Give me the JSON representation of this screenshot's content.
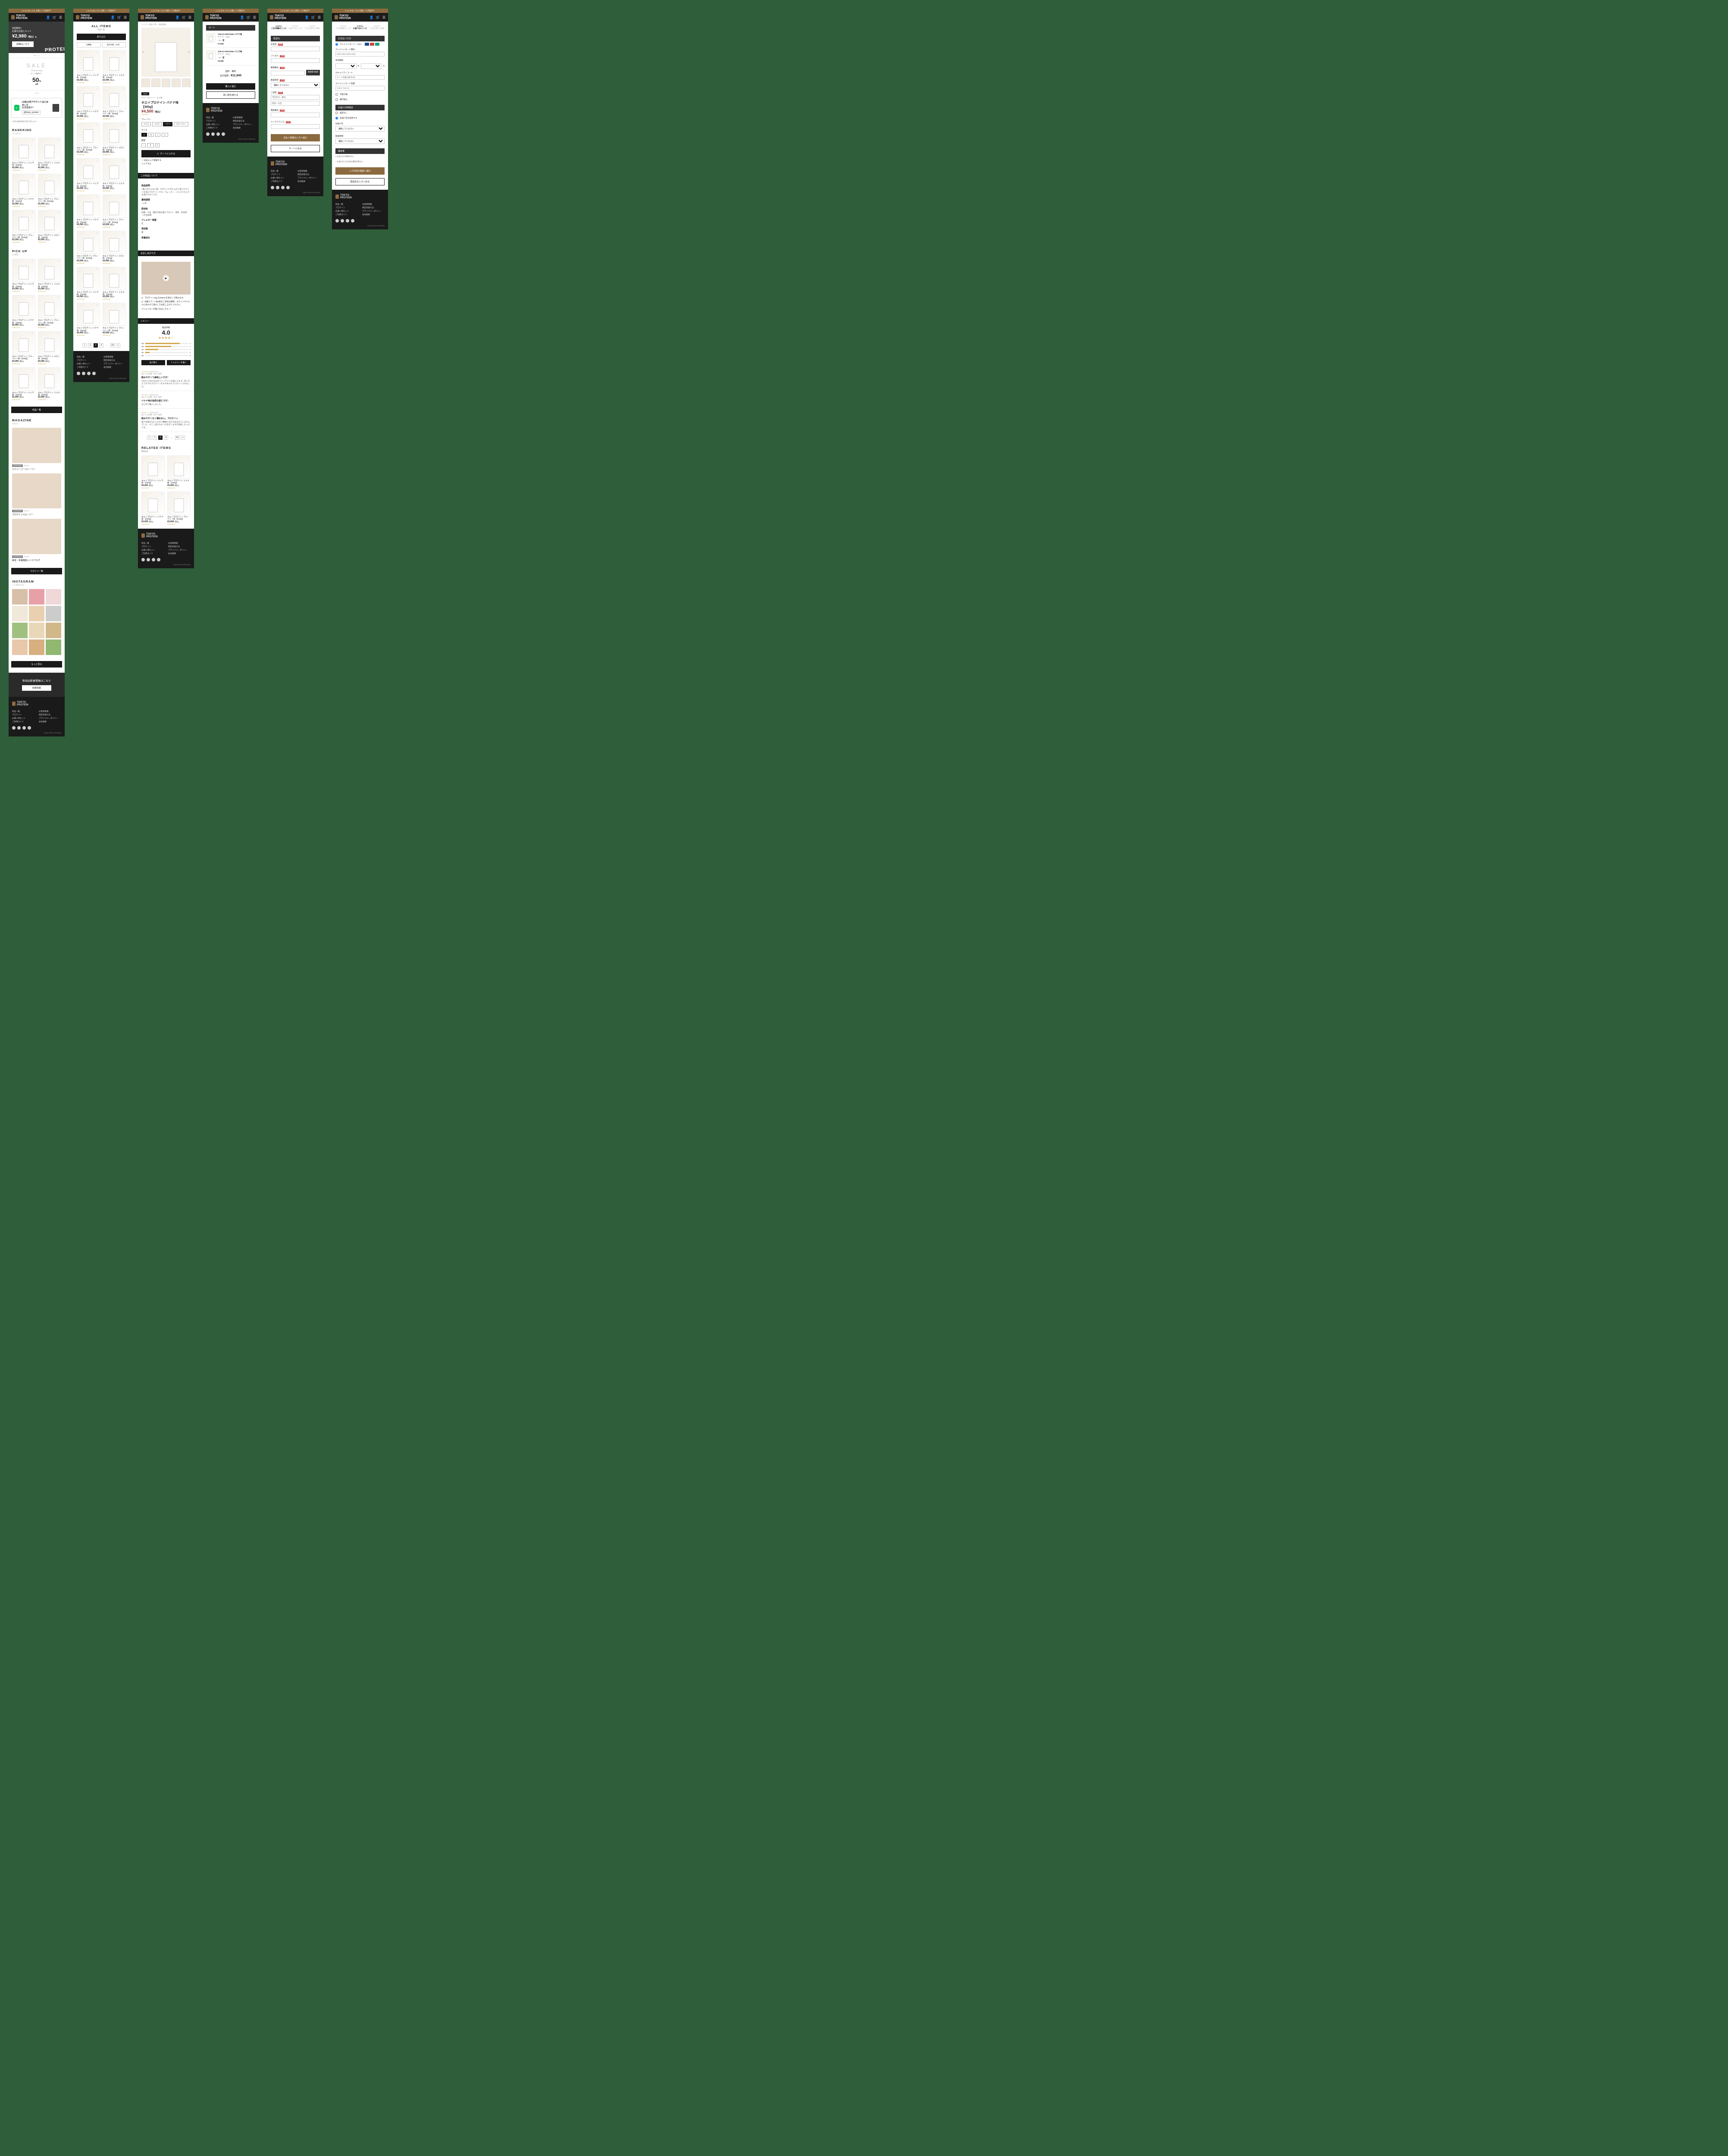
{
  "brand": {
    "name": "TOKYO\nPROTEIN",
    "banner": "こんにちは○○さん お買い トピ限定中！"
  },
  "header_icons": {
    "user": "👤",
    "cart": "🛒",
    "menu": "☰"
  },
  "hero": {
    "line1": "初回限定！",
    "line2": "お得なお試しセット",
    "price": "¥2,980",
    "tax": "（税込）p",
    "cta": "詳細はこちら",
    "bg_logo": "PROTEIN"
  },
  "sale": {
    "big": "SALE",
    "sub": "7th anniversary",
    "label": "セール開催中！",
    "pct": "50",
    "unit": "%",
    "off": "off"
  },
  "line": {
    "title": "LINE公式アカウントはじめました",
    "sub": "友達募集中！",
    "id": "@tokyo_protein",
    "note": "お得な最新情報を受け取れます！"
  },
  "ranking": {
    "h": "RANKKING",
    "s": "ランキング"
  },
  "pickup": {
    "h": "PICK UP",
    "s": "いち押し"
  },
  "btn_all": "商品一覧",
  "magazine": {
    "h": "MAGAZINE",
    "s": "マガジン",
    "btn": "マガジン一覧"
  },
  "mags": [
    {
      "tag": "CATEGORY",
      "date": "2022.01",
      "title": "エナジーバーストーリー"
    },
    {
      "tag": "CATEGORY",
      "date": "2022.01",
      "title": "プロテインスムージー"
    },
    {
      "tag": "CATEGORY",
      "date": "2022.01",
      "title": "美容・栄養機能レシピブログ"
    }
  ],
  "insta": {
    "h": "INSTAGRAM",
    "s": "インスタグラム",
    "btn": "もっと見る"
  },
  "news_banner": {
    "t": "新商品新着情報はこちら",
    "btn": "新着情報"
  },
  "footer": {
    "cols": [
      [
        "商品一覧",
        "プロテイン",
        "お買い得セット",
        "ご利用ガイド"
      ],
      [
        "お客様情報",
        "特定商取引法",
        "プライバシーポリシー",
        "会社概要"
      ]
    ],
    "copy": "©2022 TOKYO PROTEIN"
  },
  "products": [
    {
      "name": "ホエイプロテイン バニラ味 【200g】",
      "price": "¥3,000",
      "tax": "(税込)"
    },
    {
      "name": "ホエイプロテイン ミルク味 【200g】",
      "price": "¥3,000",
      "tax": "(税込)"
    },
    {
      "name": "ホエイプロテイン バナナ味 【200g】",
      "price": "¥3,000",
      "tax": "(税込)"
    },
    {
      "name": "ホエイプロテイン ブルーベリー味 【200g】",
      "price": "¥3,000",
      "tax": "(税込)"
    },
    {
      "name": "ホエイプロテイン ブルーベリー味 【200g】",
      "price": "¥3,000",
      "tax": "(税込)"
    },
    {
      "name": "ホエイプロテイン メロン味 【200g】",
      "price": "¥3,000",
      "tax": "(税込)"
    }
  ],
  "list": {
    "h": "ALL ITEMS",
    "s": "商品一覧",
    "filter_btn": "絞り込む",
    "f1": "在庫順",
    "f2": "表示件数（12件）"
  },
  "pager": {
    "prev": "<",
    "p1": "1",
    "p2": "2",
    "p3": "3",
    "dots": "…",
    "last": "10",
    "next": ">"
  },
  "detail": {
    "crumbs": "トップ ＞ 商品一覧 ＞ 商品詳細",
    "sale_tag": "SALE",
    "cat": "ホエイプロテイン：全９種",
    "title": "ホエイプロテイン バナナ味 【300g】",
    "price": "¥4,500",
    "tax": "（税込）",
    "flavor_l": "フレーバー",
    "flavors": [
      "バニラ",
      "ミルク",
      "バナナ",
      "ブルーベリー"
    ],
    "size_l": "サイズ",
    "sizes": [
      "S",
      "M",
      "L",
      "LL"
    ],
    "qty_l": "数量",
    "qty": "1",
    "cart": "🛒 カートに入れる",
    "fav": "♡ お気に入り登録する",
    "share": "シェアする",
    "about_h": "この商品について",
    "desc_h": "商品説明",
    "desc": "○最上のたんぱく質。タオルミナのたんぱく質とビタミンを含むプロテインです。ウォーター・ミルクどちらでも溶けやすいです。",
    "exp_h": "賞味期限",
    "exp": "○ヶ月",
    "ing_h": "原材料",
    "ing": "砂糖、大豆（遺伝子組み換えでない）、香料、乳化剤（大豆由来）",
    "alg_h": "アレルギー物質",
    "alg": "乳",
    "add_h": "添加物",
    "add": "無",
    "nut_h": "栄養成分",
    "nut": "…",
    "rec_h": "お召しあがり方",
    "rec_t1": "1）プロテイン30g を250mLを溶かして飲みます。",
    "rec_t2": "2）付属スプーン約3杯をご参考の標準。ホワイトやミルクにあわせて溶かしてお召し上がりください。",
    "rec_t3": "※シェイカーの使い方はこちら ＞",
    "rev_h": "レビュー",
    "rev_l": "総合評価",
    "score": "4.0",
    "bars": [
      [
        "★5",
        80,
        "1"
      ],
      [
        "★4",
        60,
        "1"
      ],
      [
        "★3",
        30,
        "1"
      ],
      [
        "★2",
        10,
        "0"
      ],
      [
        "★1",
        0,
        "0"
      ]
    ],
    "rev_sort": "並び替え",
    "rev_write": "✎ レビューを書く",
    "reviews": [
      {
        "u": "あいうえお様 / 20代 / 女性",
        "d": "2022.01.01",
        "stars": 5,
        "t": "飲みやすくて美味しいです！",
        "b": "TOKYO PROTEINのファンでいつも飲んでます。友人からコチラのプロテインをすすめられプレゼントされました。"
      },
      {
        "u": "あいうえお様 / 20代 / 女性",
        "d": "2022.01.01",
        "stars": 4,
        "t": "バナナ味が自然な感じです！",
        "b": "まとめて購入しました。"
      },
      {
        "u": "あいうえお様 / 20代 / 女性",
        "d": "2022.01.01",
        "stars": 3,
        "t": "飲みやすくなく薄めない。プロテイン",
        "b": "抜け水感のなかったので種類と甘さの含まれていませんでした。すこし溶けなかった気がしますが美味しかったです。"
      }
    ],
    "rel_h": "RELATED ITEMS",
    "rel_s": "関連商品"
  },
  "cart": {
    "h": "カート",
    "items": [
      {
        "name": "TOKYO PROTEIN バナナ味",
        "spec": "サイズ：200g",
        "price": "¥7,960"
      },
      {
        "name": "TOKYO PROTEIN バニラ味",
        "spec": "サイズ：300g",
        "price": "¥3,980"
      }
    ],
    "ship": "送料：無料",
    "total_l": "合計金額：",
    "total": "¥11,940",
    "buy": "購入に進む",
    "continue": "買い物を続ける"
  },
  "checkout": {
    "steps": [
      "STEP01",
      "STEP02",
      "STEP03"
    ],
    "step_labels": [
      "ご注文情報のご入力",
      "お届け先のご入力",
      "ご注文内容のご確認"
    ],
    "h_ship": "配送先",
    "f_name": "お名前",
    "f_kana": "フリガナ",
    "f_zip": "郵便番号",
    "zip_btn": "郵便番号検索",
    "f_pref": "都道府県",
    "f_city": "ご住所",
    "f_tel": "電話番号",
    "f_mail": "メールアドレス",
    "ph_city": "市区町村・番地",
    "ph_bldg": "建物・号室",
    "btn_pay": "支払い情報の入力へ進む",
    "btn_back": "カートに戻る",
    "h_pay": "お支払い方法",
    "r_cc": "クレジットカード・VISA",
    "r_cod": "代金引換",
    "r_bank": "銀行振込",
    "cc_no": "クレジットカード番号",
    "cc_no_ph": "0000 0000 0000 0000",
    "cc_exp": "有効期限",
    "cc_cvc": "セキュリティコード",
    "cc_cvc_ph": "カード背面の数字3桁",
    "cc_name": "クレジットカード名義",
    "cc_name_ph": "TARO TOKYO",
    "sel_ph": "選択してください",
    "year": "年",
    "month": "月",
    "h_date": "お届け日時指定",
    "r_date_no": "指定なし",
    "r_date_yes": "お届け日を指定する",
    "date_l": "お届け日",
    "time_l": "配送時間",
    "h_note": "備考等",
    "note_r1": "● お届け先の情報を同じ",
    "note_r2": "○ お届け先と注文者の情報が異なる",
    "btn_confirm": "入力内容の確認へ進む",
    "btn_back2": "配送先の入力へ戻る"
  }
}
